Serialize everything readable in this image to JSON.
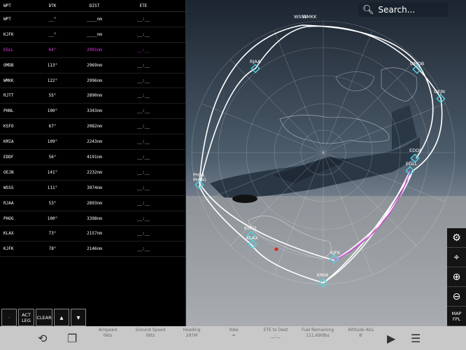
{
  "fpl": {
    "headers": {
      "wpt": "WPT",
      "dtk": "DTK",
      "dist": "DIST",
      "ete": "ETE"
    },
    "rows": [
      {
        "wpt": "WPT",
        "dtk": "__°",
        "dist": "____nm",
        "ete": "__:__"
      },
      {
        "wpt": "KJFK",
        "dtk": "__°",
        "dist": "____nm",
        "ete": "__:__"
      },
      {
        "wpt": "EGLL",
        "dtk": "64°",
        "dist": "2991nm",
        "ete": "__:__"
      },
      {
        "wpt": "OMDB",
        "dtk": "113°",
        "dist": "2969nm",
        "ete": "__:__"
      },
      {
        "wpt": "WMKK",
        "dtk": "122°",
        "dist": "2996nm",
        "ete": "__:__"
      },
      {
        "wpt": "RJTT",
        "dtk": "55°",
        "dist": "2890nm",
        "ete": "__:__"
      },
      {
        "wpt": "PHNL",
        "dtk": "100°",
        "dist": "3343nm",
        "ete": "__:__"
      },
      {
        "wpt": "KSFO",
        "dtk": "67°",
        "dist": "2082nm",
        "ete": "__:__"
      },
      {
        "wpt": "KMIA",
        "dtk": "109°",
        "dist": "2243nm",
        "ete": "__:__"
      },
      {
        "wpt": "EDDF",
        "dtk": "56°",
        "dist": "4191nm",
        "ete": "__:__"
      },
      {
        "wpt": "OEJN",
        "dtk": "141°",
        "dist": "2232nm",
        "ete": "__:__"
      },
      {
        "wpt": "WSSS",
        "dtk": "111°",
        "dist": "3974nm",
        "ete": "__:__"
      },
      {
        "wpt": "RJAA",
        "dtk": "53°",
        "dist": "2893nm",
        "ete": "__:__"
      },
      {
        "wpt": "PHOG",
        "dtk": "100°",
        "dist": "3398nm",
        "ete": "__:__"
      },
      {
        "wpt": "KLAX",
        "dtk": "73°",
        "dist": "2157nm",
        "ete": "__:__"
      },
      {
        "wpt": "KJFK",
        "dtk": "78°",
        "dist": "2146nm",
        "ete": "__:__"
      }
    ],
    "buttons": {
      "dot": "·",
      "act_leg": "ACT LEG",
      "clear": "CLEAR",
      "up": "▲",
      "down": "▼"
    }
  },
  "search": {
    "placeholder": "Search..."
  },
  "side_buttons": {
    "map_fpl": "MAP FPL"
  },
  "map_labels": [
    "WSSS",
    "WMKK",
    "RJAA",
    "OMDB",
    "OEJN",
    "EDDF",
    "EGLL",
    "PHNL",
    "PHOG",
    "KSFO",
    "KLAX",
    "KJFK",
    "KMIA"
  ],
  "status": [
    {
      "label": "Airspeed",
      "value": "0kts"
    },
    {
      "label": "Ground Speed",
      "value": "0kts"
    },
    {
      "label": "Heading",
      "value": "297M"
    },
    {
      "label": "Yoke",
      "value": ""
    },
    {
      "label": "ETE to Dest",
      "value": "__:__"
    },
    {
      "label": "Fuel Remaining",
      "value": "111,690lbs"
    },
    {
      "label": "Altitude AGL",
      "value": "8'"
    }
  ],
  "colors": {
    "route": "#ffffff",
    "active_leg": "#e040e0",
    "waypoint": "#4fd6e8"
  }
}
